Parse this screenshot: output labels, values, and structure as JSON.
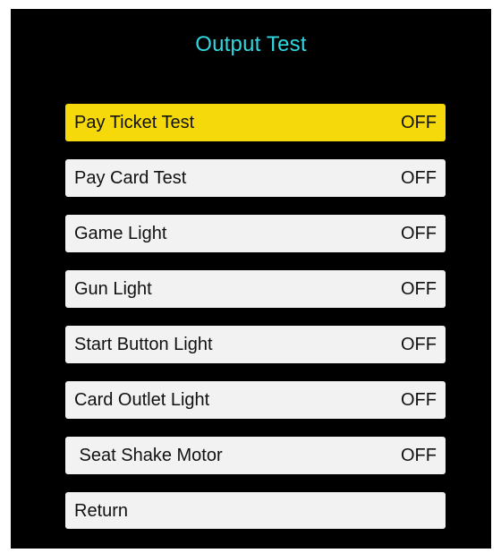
{
  "screen": {
    "title": "Output Test",
    "title_color": "#2fd8e0",
    "background_color": "#000000"
  },
  "menu": {
    "selected_color": "#f5d90a",
    "item_color": "#f2f2f2",
    "items": [
      {
        "label": "Pay Ticket Test",
        "state": "OFF",
        "selected": true
      },
      {
        "label": "Pay Card Test",
        "state": "OFF",
        "selected": false
      },
      {
        "label": "Game Light",
        "state": "OFF",
        "selected": false
      },
      {
        "label": "Gun Light",
        "state": "OFF",
        "selected": false
      },
      {
        "label": "Start Button Light",
        "state": "OFF",
        "selected": false
      },
      {
        "label": "Card Outlet Light",
        "state": "OFF",
        "selected": false
      },
      {
        "label": " Seat Shake Motor",
        "state": "OFF",
        "selected": false
      },
      {
        "label": "Return",
        "selected": false
      }
    ]
  }
}
